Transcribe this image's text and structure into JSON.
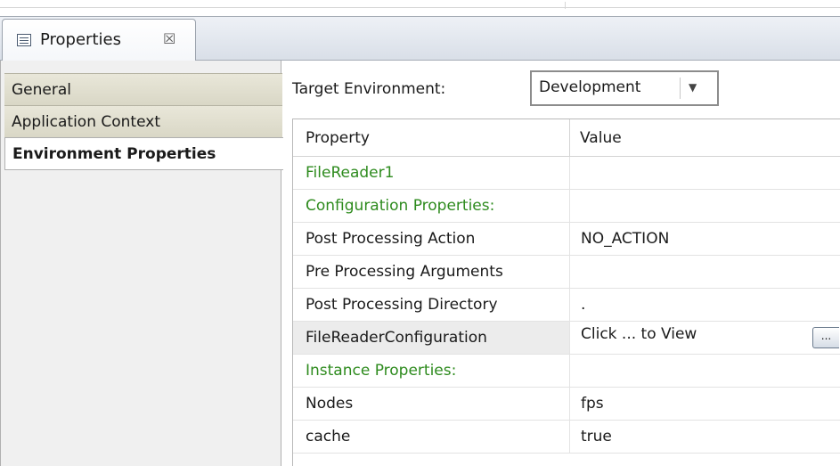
{
  "tab": {
    "title": "Properties",
    "icon": "properties-icon",
    "close_glyph": "☒"
  },
  "nav": {
    "items": [
      {
        "label": "General",
        "active": false
      },
      {
        "label": "Application Context",
        "active": false
      },
      {
        "label": "Environment Properties",
        "active": true
      }
    ]
  },
  "target_env": {
    "label": "Target Environment:",
    "selected": "Development"
  },
  "table": {
    "columns": [
      "Property",
      "Value"
    ],
    "rows": [
      {
        "property": "FileReader1",
        "value": "",
        "section": true
      },
      {
        "property": "Configuration Properties:",
        "value": "",
        "section": true
      },
      {
        "property": "Post Processing Action",
        "value": "NO_ACTION"
      },
      {
        "property": "Pre Processing Arguments",
        "value": ""
      },
      {
        "property": "Post Processing Directory",
        "value": "."
      },
      {
        "property": "FileReaderConfiguration",
        "value": "Click ... to View",
        "button_label": "..."
      },
      {
        "property": "Instance Properties:",
        "value": "",
        "section": true
      },
      {
        "property": "Nodes",
        "value": "fps"
      },
      {
        "property": "cache",
        "value": "true"
      }
    ]
  },
  "colors": {
    "section_text": "#2e8b1e",
    "nav_bg": "#e3e1d1",
    "active_nav": "#ffffff"
  }
}
